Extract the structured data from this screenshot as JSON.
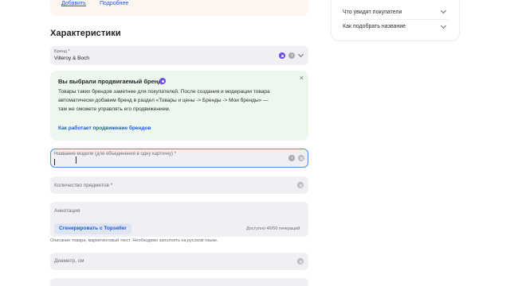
{
  "top_card": {
    "link_add": "Добавить",
    "link_more": "Подробнее"
  },
  "section": {
    "title": "Характеристики"
  },
  "brand_field": {
    "label": "Бренд *",
    "value": "Villeroy & Boch"
  },
  "promo": {
    "title": "Вы выбрали продвигаемый бренд",
    "body": "Товары таких брендов заметнее для покупателей. После создания и модерации товара автоматически добавим бренд в раздел «Товары и цены -> Бренды -> Мои бренды» — там же сможете управлять его продвижением.",
    "link": "Как работает продвижение брендов",
    "close": "×"
  },
  "model_field": {
    "label": "Название модели (для объединения в одну карточку) *"
  },
  "quantity_field": {
    "label": "Количество предметов *"
  },
  "annotation_field": {
    "label": "Аннотация"
  },
  "generate": {
    "button": "Сгенерировать с Topseller",
    "counter": "Доступно 46/50 генераций",
    "hint": "Описание товара, маркетинговый текст. Необходимо заполнять на русском языке."
  },
  "diameter_field": {
    "label": "Диаметр, см"
  },
  "right_panel": {
    "items": [
      {
        "label": "Что увидят покупатели"
      },
      {
        "label": "Как подобрать название"
      }
    ]
  },
  "colors": {
    "accent": "#1a5bd6",
    "promo_bg": "#eef7ee",
    "focus": "#4e8fe0",
    "brand_badge": "#6c49e8"
  }
}
